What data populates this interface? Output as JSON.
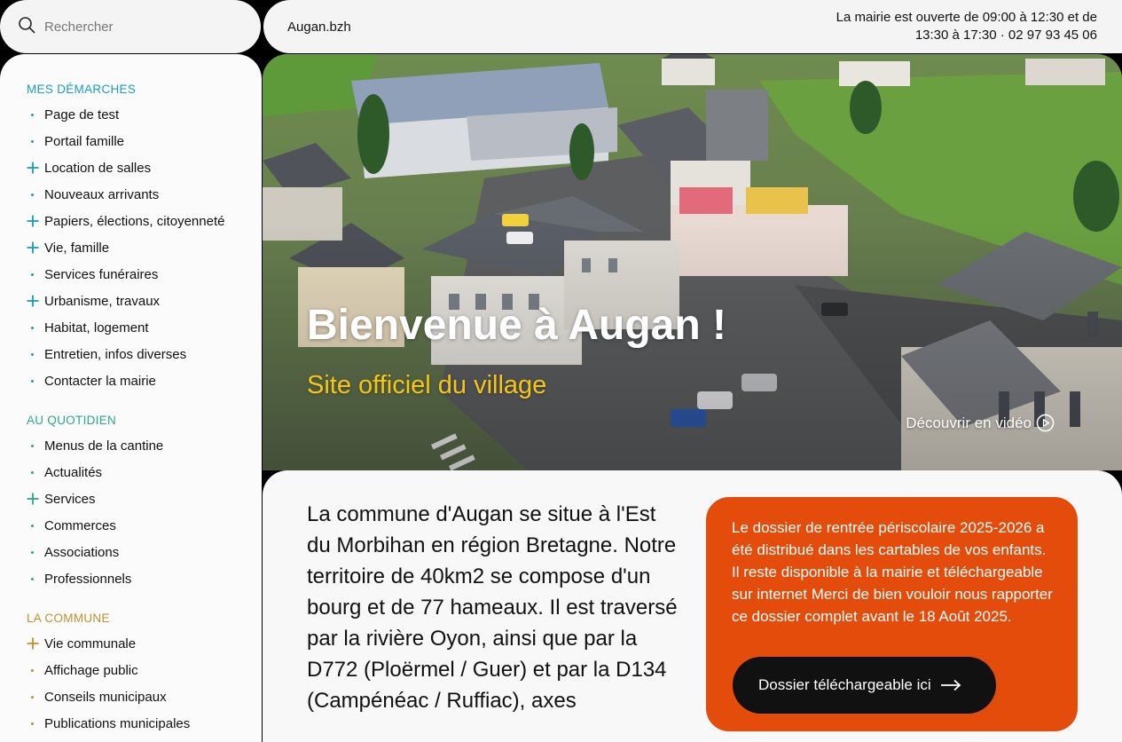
{
  "search": {
    "placeholder": "Rechercher"
  },
  "topbar": {
    "site_name": "Augan.bzh",
    "hours": "La mairie est ouverte de 09:00 à 12:30 et de 13:30 à 17:30 · 02 97 93 45 06"
  },
  "sidebar": {
    "sections": [
      {
        "title": "MES DÉMARCHES",
        "color": "#1a9dbf",
        "items": [
          {
            "label": "Page de test",
            "expandable": false
          },
          {
            "label": "Portail famille",
            "expandable": false
          },
          {
            "label": "Location de salles",
            "expandable": true
          },
          {
            "label": "Nouveaux arrivants",
            "expandable": false
          },
          {
            "label": "Papiers, élections, citoyenneté",
            "expandable": true
          },
          {
            "label": "Vie, famille",
            "expandable": true
          },
          {
            "label": "Services funéraires",
            "expandable": false
          },
          {
            "label": "Urbanisme, travaux",
            "expandable": true
          },
          {
            "label": "Habitat, logement",
            "expandable": false
          },
          {
            "label": "Entretien, infos diverses",
            "expandable": false
          },
          {
            "label": "Contacter la mairie",
            "expandable": false
          }
        ]
      },
      {
        "title": "AU QUOTIDIEN",
        "color": "#2aa88a",
        "items": [
          {
            "label": "Menus de la cantine",
            "expandable": false
          },
          {
            "label": "Actualités",
            "expandable": false
          },
          {
            "label": "Services",
            "expandable": true
          },
          {
            "label": "Commerces",
            "expandable": false
          },
          {
            "label": "Associations",
            "expandable": false
          },
          {
            "label": "Professionnels",
            "expandable": false
          }
        ]
      },
      {
        "title": "LA COMMUNE",
        "color": "#c0912a",
        "items": [
          {
            "label": "Vie communale",
            "expandable": true
          },
          {
            "label": "Affichage public",
            "expandable": false
          },
          {
            "label": "Conseils municipaux",
            "expandable": false
          },
          {
            "label": "Publications municipales",
            "expandable": false
          }
        ]
      }
    ]
  },
  "hero": {
    "title": "Bienvenue à Augan !",
    "subtitle": "Site officiel du village",
    "video_link": "Découvrir en vidéo"
  },
  "main": {
    "intro": "La commune d'Augan se situe à l'Est du Morbihan en région Bretagne. Notre territoire de 40km2 se compose d'un bourg et de 77 hameaux. Il est traversé par la rivière Oyon, ainsi que par la D772 (Ploërmel / Guer) et par la D134 (Campénéac / Ruffiac), axes",
    "notice": {
      "text": "Le dossier de rentrée périscolaire 2025-2026 a été distribué dans les cartables de vos enfants. Il reste disponible à la mairie et téléchargeable sur internet Merci de bien vouloir nous rapporter ce dossier complet avant le 18 Août 2025.",
      "button": "Dossier téléchargeable ici",
      "color": "#e34c0b"
    }
  }
}
